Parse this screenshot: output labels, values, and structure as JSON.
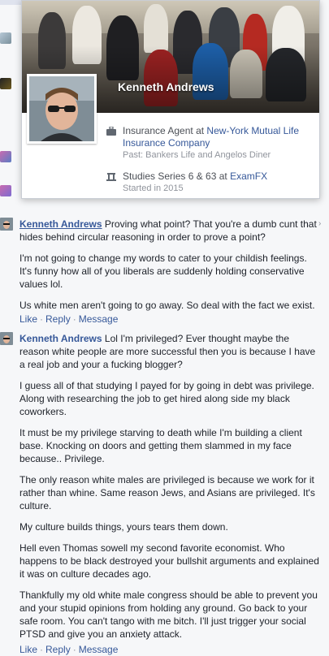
{
  "hovercard": {
    "name": "Kenneth Andrews",
    "work_title_prefix": "Insurance Agent at ",
    "work_company": "New-York Mutual Life Insurance Company",
    "work_past": "Past: Bankers Life and Angelos Diner",
    "edu_prefix": "Studies Series 6 & 63 at ",
    "edu_school": "ExamFX",
    "edu_started": "Started in 2015"
  },
  "comments": [
    {
      "author": "Kenneth Andrews",
      "first_text": "Proving what point? That you're a dumb cunt that hides behind circular reasoning in order to prove a point?",
      "paragraphs": [
        "I'm not going to change my words to cater to your childish feelings. It's funny how all of you liberals are suddenly holding conservative values lol.",
        "Us white men aren't going to go away. So deal with the fact we exist."
      ],
      "actions": [
        "Like",
        "Reply",
        "Message"
      ]
    },
    {
      "author": "Kenneth Andrews",
      "first_text": "Lol I'm privileged? Ever thought maybe the reason white people are more successful then you is because I have a real job and your a fucking blogger?",
      "paragraphs": [
        "I guess all of that studying I payed for by going in debt was privilege. Along with researching the job to get hired along side my black coworkers.",
        "It must be my privilege starving to death while I'm building a client base. Knocking on doors and getting them slammed in my face because.. Privilege.",
        "The only reason white males are privileged is because we work for it rather than whine. Same reason Jews, and Asians are privileged. It's culture.",
        "My culture builds things, yours tears them down.",
        "Hell even Thomas sowell my second favorite economist. Who happens to be black destroyed your bullshit arguments and explained it was on culture decades ago.",
        "Thankfully my old white male congress should be able to prevent you and your stupid opinions from holding any ground. Go back to your safe room. You can't tango with me bitch. I'll just trigger your social PTSD and give you an anxiety attack."
      ],
      "actions": [
        "Like",
        "Reply",
        "Message"
      ]
    }
  ],
  "colors": {
    "link": "#365899",
    "text": "#1d2129",
    "muted": "#90949c"
  },
  "icons": {
    "work": "briefcase-icon",
    "edu": "graduation-cap-icon",
    "menu": "chevron-right-icon"
  }
}
